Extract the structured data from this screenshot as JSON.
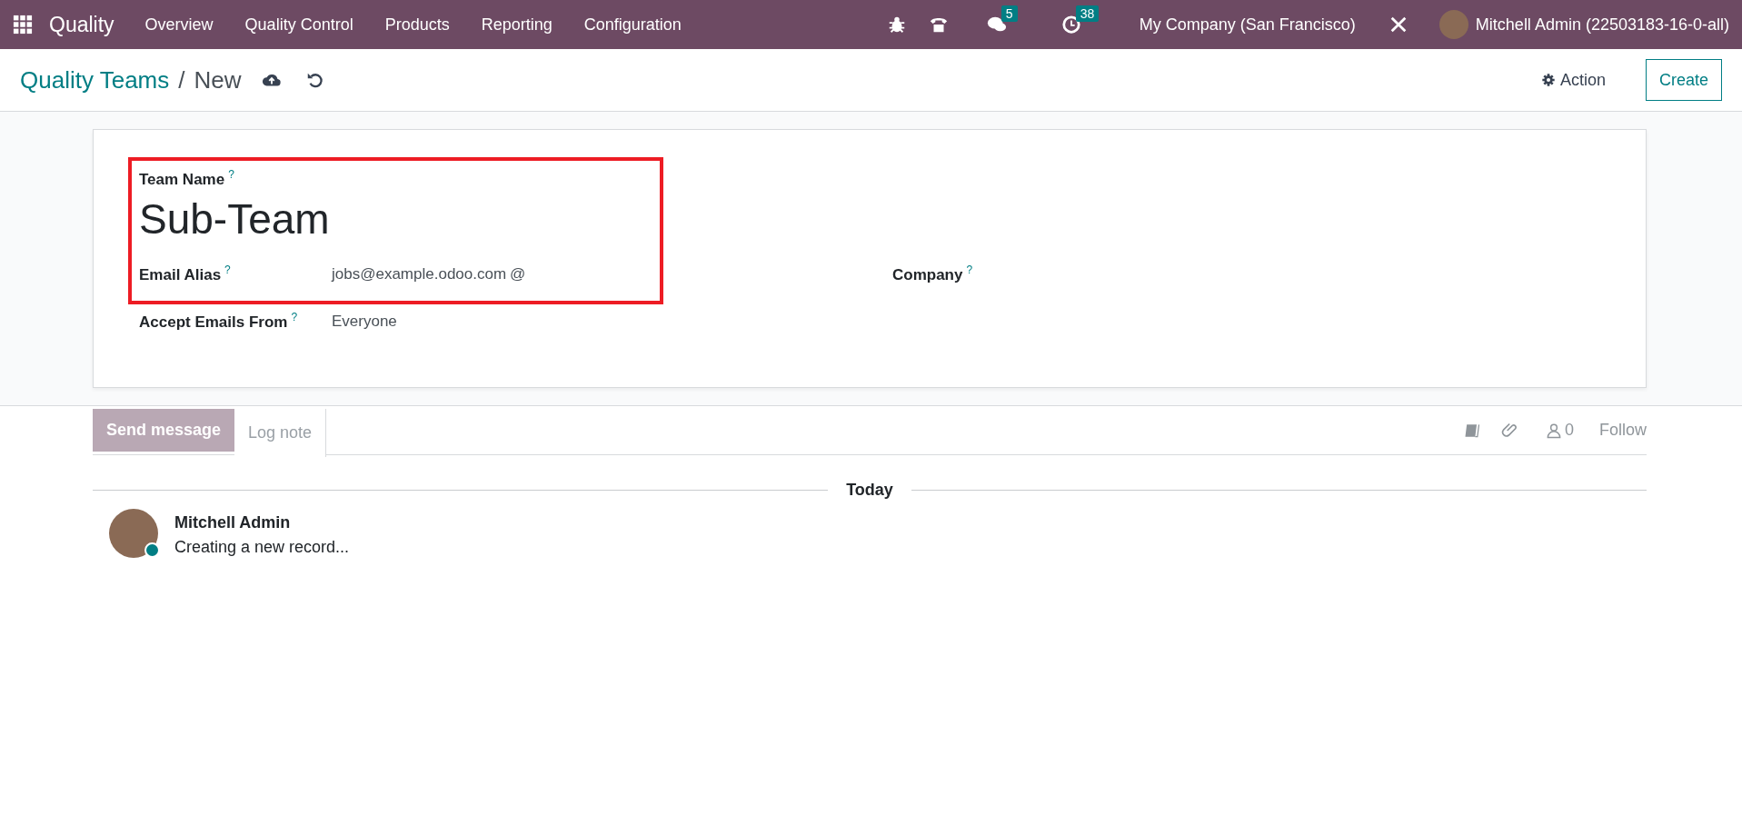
{
  "navbar": {
    "app_name": "Quality",
    "menu": [
      "Overview",
      "Quality Control",
      "Products",
      "Reporting",
      "Configuration"
    ],
    "messages_badge": "5",
    "activities_badge": "38",
    "company": "My Company (San Francisco)",
    "user": "Mitchell Admin (22503183-16-0-all)"
  },
  "control_panel": {
    "breadcrumb_parent": "Quality Teams",
    "breadcrumb_separator": "/",
    "breadcrumb_current": "New",
    "action": "Action",
    "create": "Create"
  },
  "form": {
    "title_label": "Team Name",
    "title_help": "?",
    "name": "Sub-Team",
    "highlight": true,
    "left_fields": [
      {
        "label": "Email Alias",
        "help": "?",
        "value": "jobs@example.odoo.com",
        "suffix": "@"
      },
      {
        "label": "Accept Emails From",
        "help": "?",
        "value": "Everyone"
      }
    ],
    "right_fields": [
      {
        "label": "Company",
        "help": "?"
      }
    ]
  },
  "chatter": {
    "tabs": [
      {
        "label": "Send message",
        "selected": true
      },
      {
        "label": "Log note",
        "selected": false
      }
    ],
    "followers_count": "0",
    "follow": "Follow",
    "date_separator": "Today",
    "messages": [
      {
        "author": "Mitchell Admin",
        "body": "Creating a new record...",
        "online": true
      }
    ]
  }
}
